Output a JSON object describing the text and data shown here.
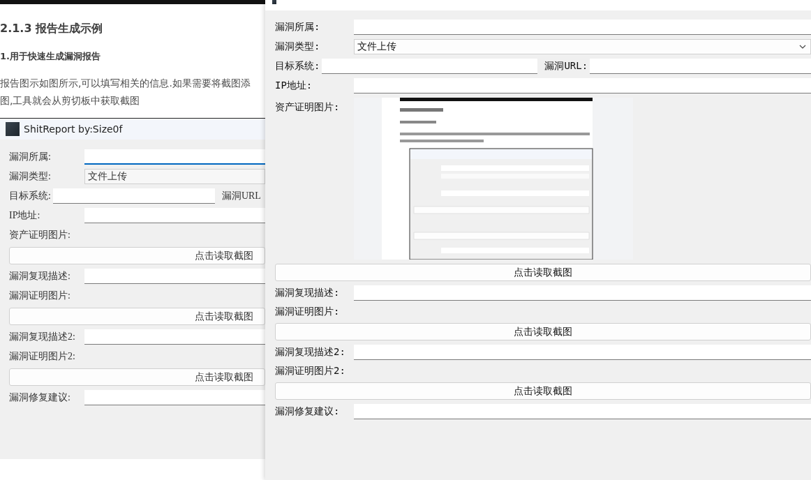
{
  "document": {
    "heading": "2.1.3 报告生成示例",
    "subheading": "1.用于快速生成漏洞报告",
    "paragraph_lines": [
      "报告图示如图所示,可以填写相关的信息.如果需要将截图添",
      "图,工具就会从剪切板中获取截图"
    ]
  },
  "background_window": {
    "title": "ShitReport by:Size0f",
    "rows": [
      {
        "kind": "text",
        "label": "漏洞所属:",
        "input": {
          "focused": true
        }
      },
      {
        "kind": "combo",
        "label": "漏洞类型:",
        "value": "文件上传"
      },
      {
        "kind": "pair",
        "fields": [
          {
            "label": "目标系统:",
            "input": {
              "focused": false
            }
          },
          {
            "label": "漏洞URL"
          }
        ]
      },
      {
        "kind": "text",
        "label": "IP地址:",
        "input": {
          "focused": false
        }
      },
      {
        "kind": "label",
        "label": "资产证明图片:"
      },
      {
        "kind": "button",
        "label": "点击读取截图"
      },
      {
        "kind": "text",
        "label": "漏洞复现描述:",
        "input": {
          "focused": false
        }
      },
      {
        "kind": "label",
        "label": "漏洞证明图片:"
      },
      {
        "kind": "button",
        "label": "点击读取截图"
      },
      {
        "kind": "text",
        "label": "漏洞复现描述2:",
        "input": {
          "focused": false
        }
      },
      {
        "kind": "label",
        "label": "漏洞证明图片2:"
      },
      {
        "kind": "button",
        "label": "点击读取截图"
      },
      {
        "kind": "text",
        "label": "漏洞修复建议:",
        "input": {
          "focused": false
        }
      }
    ]
  },
  "foreground_window": {
    "rows": [
      {
        "kind": "text",
        "label": "漏洞所属:",
        "input": {
          "focused": false
        }
      },
      {
        "kind": "combo",
        "label": "漏洞类型:",
        "value": "文件上传"
      },
      {
        "kind": "pair",
        "fields": [
          {
            "label": "目标系统:",
            "input": {
              "focused": false
            }
          },
          {
            "label": "漏洞URL:",
            "input": {
              "focused": false
            }
          }
        ]
      },
      {
        "kind": "text",
        "label": "IP地址:",
        "input": {
          "focused": false
        }
      },
      {
        "kind": "picture",
        "label": "资产证明图片:"
      },
      {
        "kind": "button",
        "label": "点击读取截图"
      },
      {
        "kind": "text",
        "label": "漏洞复现描述:",
        "input": {
          "focused": false
        }
      },
      {
        "kind": "label",
        "label": "漏洞证明图片:"
      },
      {
        "kind": "button",
        "label": "点击读取截图"
      },
      {
        "kind": "text",
        "label": "漏洞复现描述2:",
        "input": {
          "focused": false
        }
      },
      {
        "kind": "label",
        "label": "漏洞证明图片2:"
      },
      {
        "kind": "button",
        "label": "点击读取截图"
      },
      {
        "kind": "text",
        "label": "漏洞修复建议:",
        "input": {
          "focused": false
        }
      }
    ]
  }
}
